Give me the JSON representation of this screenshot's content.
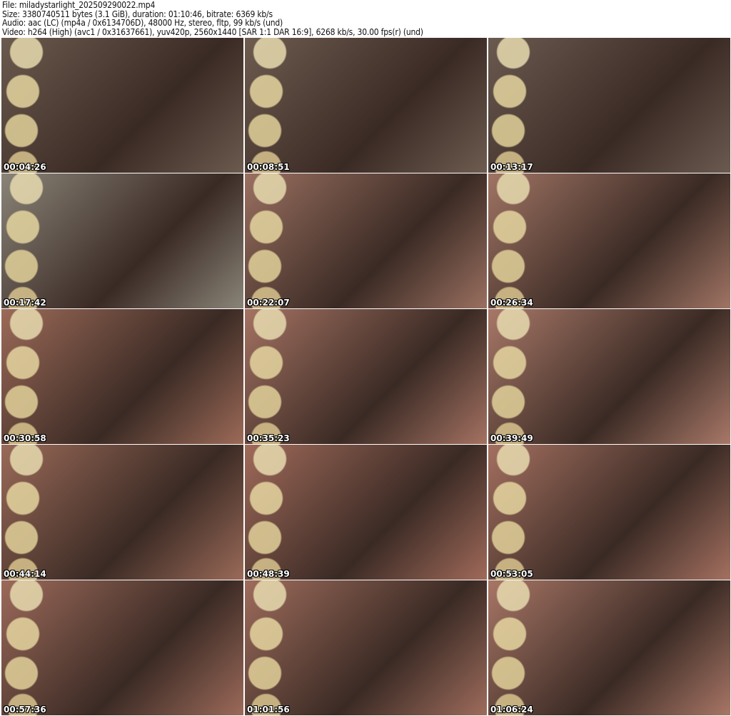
{
  "header": {
    "file": "File: miladystarlight_202509290022.mp4",
    "size": "Size: 3380740511 bytes (3.1 GiB), duration: 01:10:46, bitrate: 6369 kb/s",
    "audio": "Audio: aac (LC) (mp4a / 0x6134706D), 48000 Hz, stereo, fltp, 99 kb/s (und)",
    "video": "Video: h264 (High) (avc1 / 0x31637661), yuv420p, 2560x1440 [SAR 1:1 DAR 16:9], 6268 kb/s, 30.00 fps(r) (und)"
  },
  "thumbnails": [
    {
      "time": "00:04:26",
      "tone": "#6b5a4e"
    },
    {
      "time": "00:08:51",
      "tone": "#6e5c50"
    },
    {
      "time": "00:13:17",
      "tone": "#6a5a50"
    },
    {
      "time": "00:17:42",
      "tone": "#8a8478"
    },
    {
      "time": "00:22:07",
      "tone": "#9a7060"
    },
    {
      "time": "00:26:34",
      "tone": "#a07464"
    },
    {
      "time": "00:30:58",
      "tone": "#9c6a58"
    },
    {
      "time": "00:35:23",
      "tone": "#a47262"
    },
    {
      "time": "00:39:49",
      "tone": "#a87868"
    },
    {
      "time": "00:44:14",
      "tone": "#9a6a58"
    },
    {
      "time": "00:48:39",
      "tone": "#a06a5a"
    },
    {
      "time": "00:53:05",
      "tone": "#a47060"
    },
    {
      "time": "00:57:36",
      "tone": "#9c6a5a"
    },
    {
      "time": "01:01:56",
      "tone": "#9e6c5c"
    },
    {
      "time": "01:06:24",
      "tone": "#a87666"
    }
  ]
}
